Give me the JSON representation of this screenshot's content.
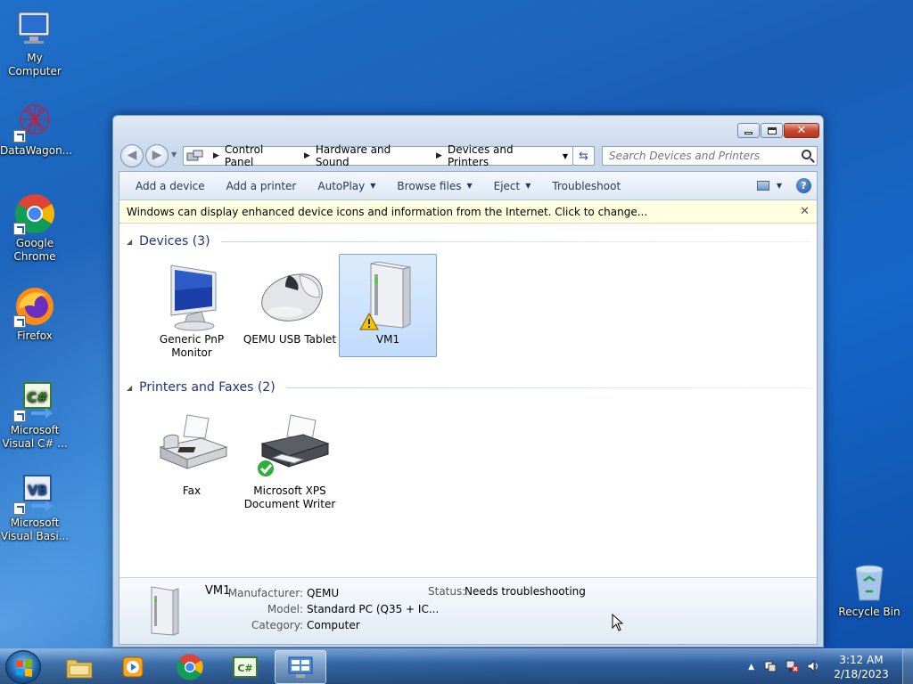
{
  "desktop": {
    "icons": [
      {
        "label": "My Computer"
      },
      {
        "label": "DataWagon..."
      },
      {
        "label": "Google Chrome"
      },
      {
        "label": "Firefox"
      },
      {
        "label": "Microsoft Visual C# ..."
      },
      {
        "label": "Microsoft Visual Basi..."
      },
      {
        "label": "Recycle Bin"
      }
    ]
  },
  "window": {
    "address": {
      "crumbs": [
        "Control Panel",
        "Hardware and Sound",
        "Devices and Printers"
      ]
    },
    "search": {
      "placeholder": "Search Devices and Printers"
    },
    "toolbar": {
      "add_device": "Add a device",
      "add_printer": "Add a printer",
      "autoplay": "AutoPlay",
      "browse_files": "Browse files",
      "eject": "Eject",
      "troubleshoot": "Troubleshoot"
    },
    "infobar": {
      "text": "Windows can display enhanced device icons and information from the Internet. Click to change..."
    },
    "groups": {
      "devices": {
        "title": "Devices (3)",
        "items": [
          {
            "label": "Generic PnP Monitor",
            "icon": "monitor-icon"
          },
          {
            "label": "QEMU USB Tablet",
            "icon": "mouse-icon"
          },
          {
            "label": "VM1",
            "icon": "computer-tower-icon",
            "warning": true
          }
        ]
      },
      "printers": {
        "title": "Printers and Faxes (2)",
        "items": [
          {
            "label": "Fax",
            "icon": "fax-icon"
          },
          {
            "label": "Microsoft XPS Document Writer",
            "icon": "printer-icon",
            "default": true
          }
        ]
      }
    },
    "details": {
      "name": "VM1",
      "manufacturer_label": "Manufacturer:",
      "manufacturer": "QEMU",
      "model_label": "Model:",
      "model": "Standard PC (Q35 + IC...",
      "category_label": "Category:",
      "category": "Computer",
      "status_label": "Status:",
      "status": "Needs troubleshooting"
    }
  },
  "taskbar": {
    "clock": {
      "time": "3:12 AM",
      "date": "2/18/2023"
    }
  }
}
